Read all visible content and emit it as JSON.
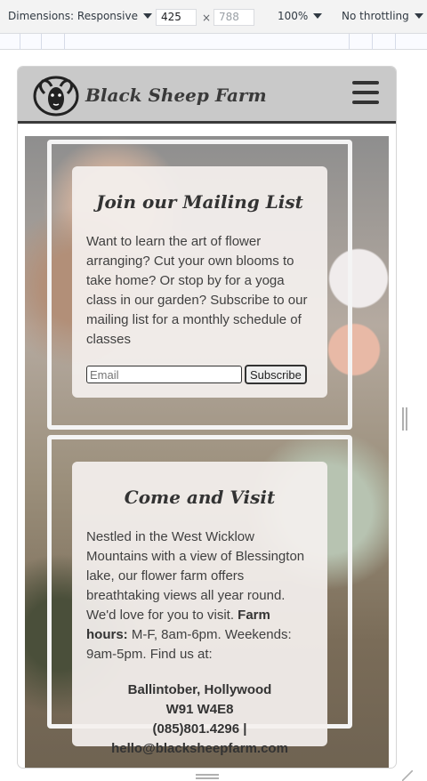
{
  "devtools": {
    "dimensions_label": "Dimensions: Responsive",
    "width": "425",
    "height": "788",
    "times": "×",
    "zoom": "100%",
    "throttling": "No throttling"
  },
  "site": {
    "brand": "Black Sheep Farm",
    "mailing": {
      "title": "Join our Mailing List",
      "body": "Want to learn the art of flower arranging? Cut your own blooms to take home? Or stop by for a yoga class in our garden? Subscribe to our mailing list for a monthly schedule of classes",
      "email_placeholder": "Email",
      "subscribe_label": "Subscribe"
    },
    "visit": {
      "title": "Come and Visit",
      "body": "Nestled in the West Wicklow Mountains with a view of Blessington lake, our flower farm offers breathtaking views all year round. We'd love for you to visit.",
      "hours_label": "Farm hours:",
      "hours_text": "M-F, 8am-6pm. Weekends: 9am-5pm. Find us at:",
      "address_line1": "Ballintober, Hollywood",
      "address_line2": "W91 W4E8",
      "phone": "(085)801.4296 |",
      "email": "hello@blacksheepfarm.com"
    }
  }
}
